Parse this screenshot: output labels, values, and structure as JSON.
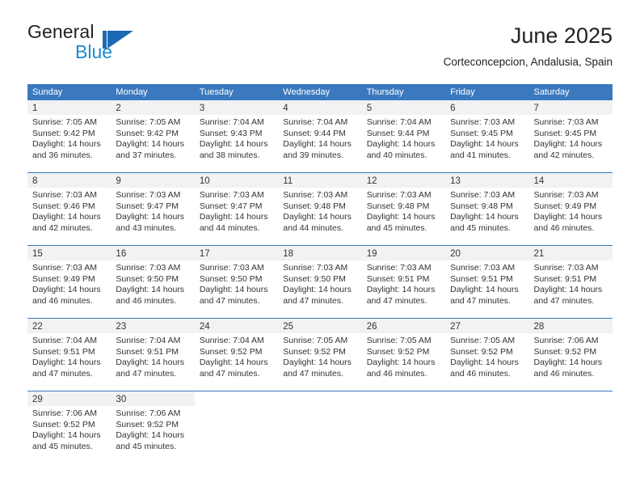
{
  "brand": {
    "line1": "General",
    "line2": "Blue",
    "mark_icon": "general-blue-flag-icon",
    "color_dark": "#1b69b4",
    "color_light": "#1b8bd0"
  },
  "header": {
    "title": "June 2025",
    "subtitle": "Corteconcepcion, Andalusia, Spain"
  },
  "theme": {
    "header_blue": "#3b79bf",
    "daynum_band": "#f2f2f2",
    "text": "#333333"
  },
  "calendar": {
    "weekdays": [
      "Sunday",
      "Monday",
      "Tuesday",
      "Wednesday",
      "Thursday",
      "Friday",
      "Saturday"
    ],
    "weeks": [
      [
        {
          "day": "1",
          "sunrise": "Sunrise: 7:05 AM",
          "sunset": "Sunset: 9:42 PM",
          "daylight": "Daylight: 14 hours and 36 minutes."
        },
        {
          "day": "2",
          "sunrise": "Sunrise: 7:05 AM",
          "sunset": "Sunset: 9:42 PM",
          "daylight": "Daylight: 14 hours and 37 minutes."
        },
        {
          "day": "3",
          "sunrise": "Sunrise: 7:04 AM",
          "sunset": "Sunset: 9:43 PM",
          "daylight": "Daylight: 14 hours and 38 minutes."
        },
        {
          "day": "4",
          "sunrise": "Sunrise: 7:04 AM",
          "sunset": "Sunset: 9:44 PM",
          "daylight": "Daylight: 14 hours and 39 minutes."
        },
        {
          "day": "5",
          "sunrise": "Sunrise: 7:04 AM",
          "sunset": "Sunset: 9:44 PM",
          "daylight": "Daylight: 14 hours and 40 minutes."
        },
        {
          "day": "6",
          "sunrise": "Sunrise: 7:03 AM",
          "sunset": "Sunset: 9:45 PM",
          "daylight": "Daylight: 14 hours and 41 minutes."
        },
        {
          "day": "7",
          "sunrise": "Sunrise: 7:03 AM",
          "sunset": "Sunset: 9:45 PM",
          "daylight": "Daylight: 14 hours and 42 minutes."
        }
      ],
      [
        {
          "day": "8",
          "sunrise": "Sunrise: 7:03 AM",
          "sunset": "Sunset: 9:46 PM",
          "daylight": "Daylight: 14 hours and 42 minutes."
        },
        {
          "day": "9",
          "sunrise": "Sunrise: 7:03 AM",
          "sunset": "Sunset: 9:47 PM",
          "daylight": "Daylight: 14 hours and 43 minutes."
        },
        {
          "day": "10",
          "sunrise": "Sunrise: 7:03 AM",
          "sunset": "Sunset: 9:47 PM",
          "daylight": "Daylight: 14 hours and 44 minutes."
        },
        {
          "day": "11",
          "sunrise": "Sunrise: 7:03 AM",
          "sunset": "Sunset: 9:48 PM",
          "daylight": "Daylight: 14 hours and 44 minutes."
        },
        {
          "day": "12",
          "sunrise": "Sunrise: 7:03 AM",
          "sunset": "Sunset: 9:48 PM",
          "daylight": "Daylight: 14 hours and 45 minutes."
        },
        {
          "day": "13",
          "sunrise": "Sunrise: 7:03 AM",
          "sunset": "Sunset: 9:48 PM",
          "daylight": "Daylight: 14 hours and 45 minutes."
        },
        {
          "day": "14",
          "sunrise": "Sunrise: 7:03 AM",
          "sunset": "Sunset: 9:49 PM",
          "daylight": "Daylight: 14 hours and 46 minutes."
        }
      ],
      [
        {
          "day": "15",
          "sunrise": "Sunrise: 7:03 AM",
          "sunset": "Sunset: 9:49 PM",
          "daylight": "Daylight: 14 hours and 46 minutes."
        },
        {
          "day": "16",
          "sunrise": "Sunrise: 7:03 AM",
          "sunset": "Sunset: 9:50 PM",
          "daylight": "Daylight: 14 hours and 46 minutes."
        },
        {
          "day": "17",
          "sunrise": "Sunrise: 7:03 AM",
          "sunset": "Sunset: 9:50 PM",
          "daylight": "Daylight: 14 hours and 47 minutes."
        },
        {
          "day": "18",
          "sunrise": "Sunrise: 7:03 AM",
          "sunset": "Sunset: 9:50 PM",
          "daylight": "Daylight: 14 hours and 47 minutes."
        },
        {
          "day": "19",
          "sunrise": "Sunrise: 7:03 AM",
          "sunset": "Sunset: 9:51 PM",
          "daylight": "Daylight: 14 hours and 47 minutes."
        },
        {
          "day": "20",
          "sunrise": "Sunrise: 7:03 AM",
          "sunset": "Sunset: 9:51 PM",
          "daylight": "Daylight: 14 hours and 47 minutes."
        },
        {
          "day": "21",
          "sunrise": "Sunrise: 7:03 AM",
          "sunset": "Sunset: 9:51 PM",
          "daylight": "Daylight: 14 hours and 47 minutes."
        }
      ],
      [
        {
          "day": "22",
          "sunrise": "Sunrise: 7:04 AM",
          "sunset": "Sunset: 9:51 PM",
          "daylight": "Daylight: 14 hours and 47 minutes."
        },
        {
          "day": "23",
          "sunrise": "Sunrise: 7:04 AM",
          "sunset": "Sunset: 9:51 PM",
          "daylight": "Daylight: 14 hours and 47 minutes."
        },
        {
          "day": "24",
          "sunrise": "Sunrise: 7:04 AM",
          "sunset": "Sunset: 9:52 PM",
          "daylight": "Daylight: 14 hours and 47 minutes."
        },
        {
          "day": "25",
          "sunrise": "Sunrise: 7:05 AM",
          "sunset": "Sunset: 9:52 PM",
          "daylight": "Daylight: 14 hours and 47 minutes."
        },
        {
          "day": "26",
          "sunrise": "Sunrise: 7:05 AM",
          "sunset": "Sunset: 9:52 PM",
          "daylight": "Daylight: 14 hours and 46 minutes."
        },
        {
          "day": "27",
          "sunrise": "Sunrise: 7:05 AM",
          "sunset": "Sunset: 9:52 PM",
          "daylight": "Daylight: 14 hours and 46 minutes."
        },
        {
          "day": "28",
          "sunrise": "Sunrise: 7:06 AM",
          "sunset": "Sunset: 9:52 PM",
          "daylight": "Daylight: 14 hours and 46 minutes."
        }
      ],
      [
        {
          "day": "29",
          "sunrise": "Sunrise: 7:06 AM",
          "sunset": "Sunset: 9:52 PM",
          "daylight": "Daylight: 14 hours and 45 minutes."
        },
        {
          "day": "30",
          "sunrise": "Sunrise: 7:06 AM",
          "sunset": "Sunset: 9:52 PM",
          "daylight": "Daylight: 14 hours and 45 minutes."
        },
        {
          "day": "",
          "sunrise": "",
          "sunset": "",
          "daylight": ""
        },
        {
          "day": "",
          "sunrise": "",
          "sunset": "",
          "daylight": ""
        },
        {
          "day": "",
          "sunrise": "",
          "sunset": "",
          "daylight": ""
        },
        {
          "day": "",
          "sunrise": "",
          "sunset": "",
          "daylight": ""
        },
        {
          "day": "",
          "sunrise": "",
          "sunset": "",
          "daylight": ""
        }
      ]
    ]
  }
}
